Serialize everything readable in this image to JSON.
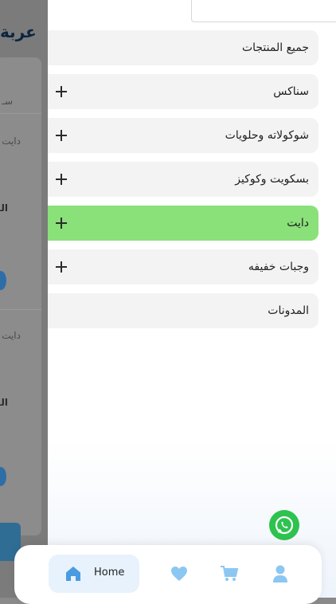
{
  "background_page": {
    "title": "عربة",
    "lines": [
      "سـ",
      "دايت",
      "الـ",
      "دايت",
      "الـ"
    ]
  },
  "drawer": {
    "menu": [
      {
        "label": "جميع المنتجات",
        "expandable": false,
        "active": false
      },
      {
        "label": "سناكس",
        "expandable": true,
        "active": false
      },
      {
        "label": "شوكولاته وحلويات",
        "expandable": true,
        "active": false
      },
      {
        "label": "بسكويت وكوكيز",
        "expandable": true,
        "active": false
      },
      {
        "label": "دايت",
        "expandable": true,
        "active": true
      },
      {
        "label": "وجبات خفيفه",
        "expandable": true,
        "active": false
      },
      {
        "label": "المدونات",
        "expandable": false,
        "active": false
      }
    ]
  },
  "bottom_nav": {
    "home_label": "Home",
    "items": [
      "home-icon",
      "heart-icon",
      "cart-icon",
      "profile-icon"
    ]
  },
  "colors": {
    "active_item": "#8ae079",
    "item_bg": "#f3f3f3",
    "nav_accent": "#4a9be0",
    "whatsapp": "#2ec24f"
  }
}
